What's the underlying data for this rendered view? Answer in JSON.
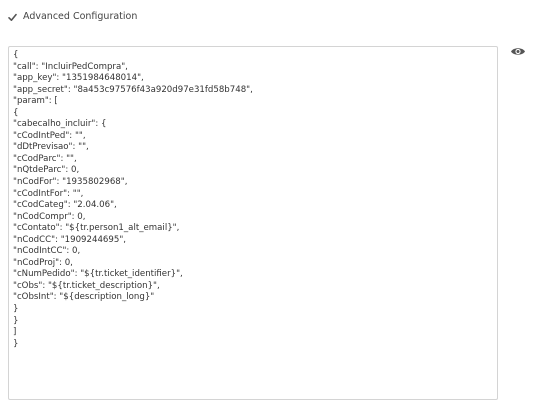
{
  "advanced_config": {
    "label": "Advanced Configuration",
    "checked": true,
    "check_icon": "check-icon"
  },
  "editor": {
    "content": "{\n\"call\": \"IncluirPedCompra\",\n\"app_key\": \"1351984648014\",\n\"app_secret\": \"8a453c97576f43a920d97e31fd58b748\",\n\"param\": [\n{\n\"cabecalho_incluir\": {\n\"cCodIntPed\": \"\",\n\"dDtPrevisao\": \"\",\n\"cCodParc\": \"\",\n\"nQtdeParc\": 0,\n\"nCodFor\": \"1935802968\",\n\"cCodIntFor\": \"\",\n\"cCodCateg\": \"2.04.06\",\n\"nCodCompr\": 0,\n\"cContato\": \"${tr.person1_alt_email}\",\n\"nCodCC\": \"1909244695\",\n\"nCodIntCC\": 0,\n\"nCodProj\": 0,\n\"cNumPedido\": \"${tr.ticket_identifier}\",\n\"cObs\": \"${tr.ticket_description}\",\n\"cObsInt\": \"${description_long}\"\n}\n}\n]\n}",
    "visibility_icon": "eye-icon"
  },
  "colors": {
    "text": "#333333",
    "border": "#d4d4d4",
    "icon": "#555555"
  }
}
